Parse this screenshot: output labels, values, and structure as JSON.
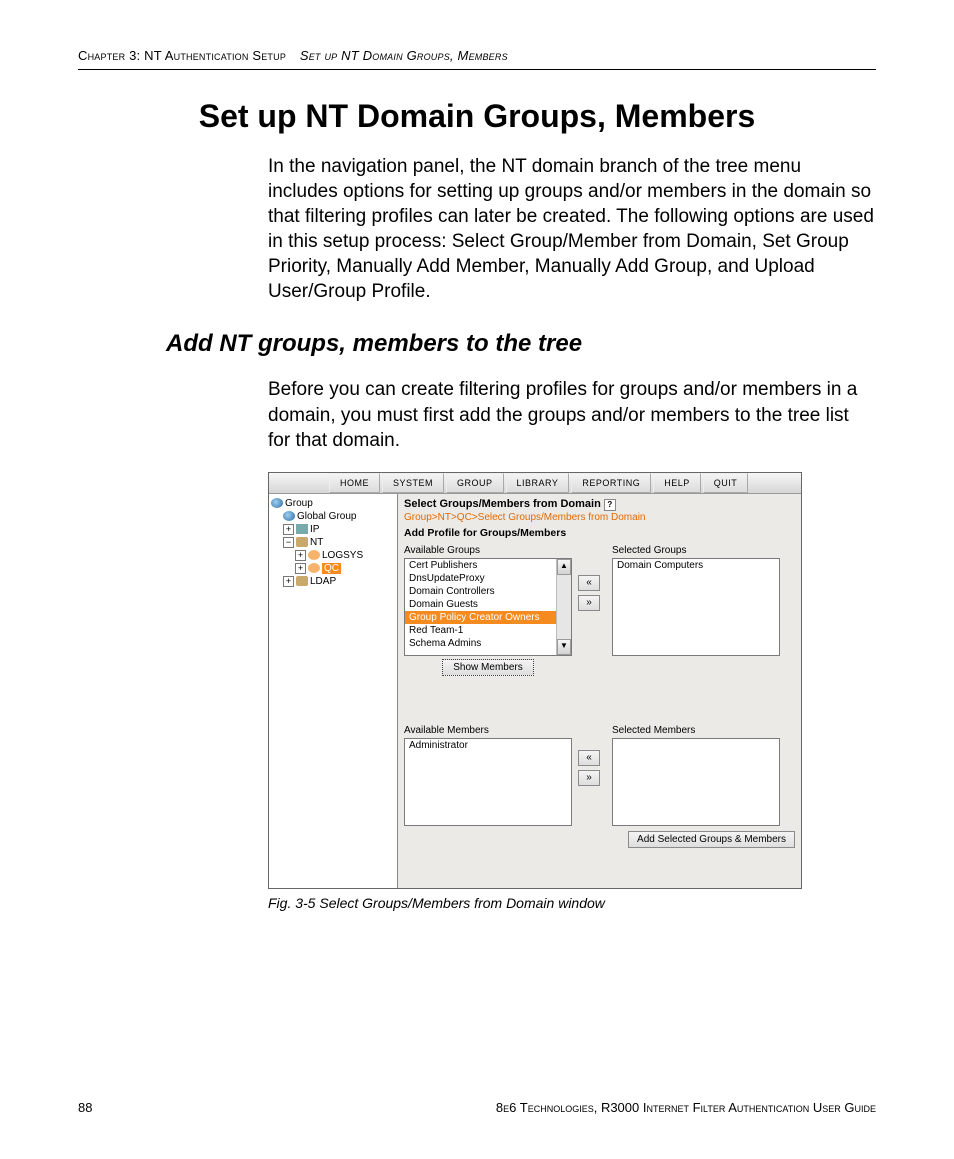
{
  "header": {
    "chapter": "Chapter 3: NT Authentication Setup",
    "section": "Set up NT Domain Groups, Members"
  },
  "title": "Set up NT Domain Groups, Members",
  "intro": "In the navigation panel, the NT domain branch of the tree menu includes options for setting up groups and/or members in the domain so that filtering profiles can later be created. The following options are used in this setup process: Select Group/Member from Domain, Set Group Priority, Manually Add Member, Manually Add Group, and Upload User/Group Profile.",
  "subhead": "Add NT groups, members to the tree",
  "subtext": "Before you can create filtering profiles for groups and/or members in a domain, you must first add the groups and/or members to the tree list for that domain.",
  "caption": "Fig. 3-5  Select Groups/Members from Domain window",
  "footer": {
    "page": "88",
    "book": "8e6 Technologies, R3000 Internet Filter Authentication User Guide"
  },
  "app": {
    "menu": [
      "HOME",
      "SYSTEM",
      "GROUP",
      "LIBRARY",
      "REPORTING",
      "HELP",
      "QUIT"
    ],
    "tree": {
      "root": "Group",
      "global": "Global Group",
      "ip": "IP",
      "nt": "NT",
      "logsys": "LOGSYS",
      "qc": "QC",
      "ldap": "LDAP"
    },
    "panel": {
      "title": "Select Groups/Members from Domain",
      "crumb": "Group>NT>QC>Select Groups/Members from Domain",
      "section": "Add Profile for Groups/Members",
      "labels": {
        "availGroups": "Available Groups",
        "selGroups": "Selected Groups",
        "availMembers": "Available Members",
        "selMembers": "Selected Members"
      },
      "availGroups": [
        "Cert Publishers",
        "DnsUpdateProxy",
        "Domain Controllers",
        "Domain Guests",
        "Group Policy Creator Owners",
        "Red Team-1",
        "Schema Admins"
      ],
      "availGroupsSelectedIndex": 4,
      "selGroups": [
        "Domain Computers"
      ],
      "availMembers": [
        "Administrator"
      ],
      "selMembers": [],
      "buttons": {
        "left": "«",
        "right": "»",
        "show": "Show Members",
        "add": "Add Selected Groups & Members"
      }
    }
  }
}
